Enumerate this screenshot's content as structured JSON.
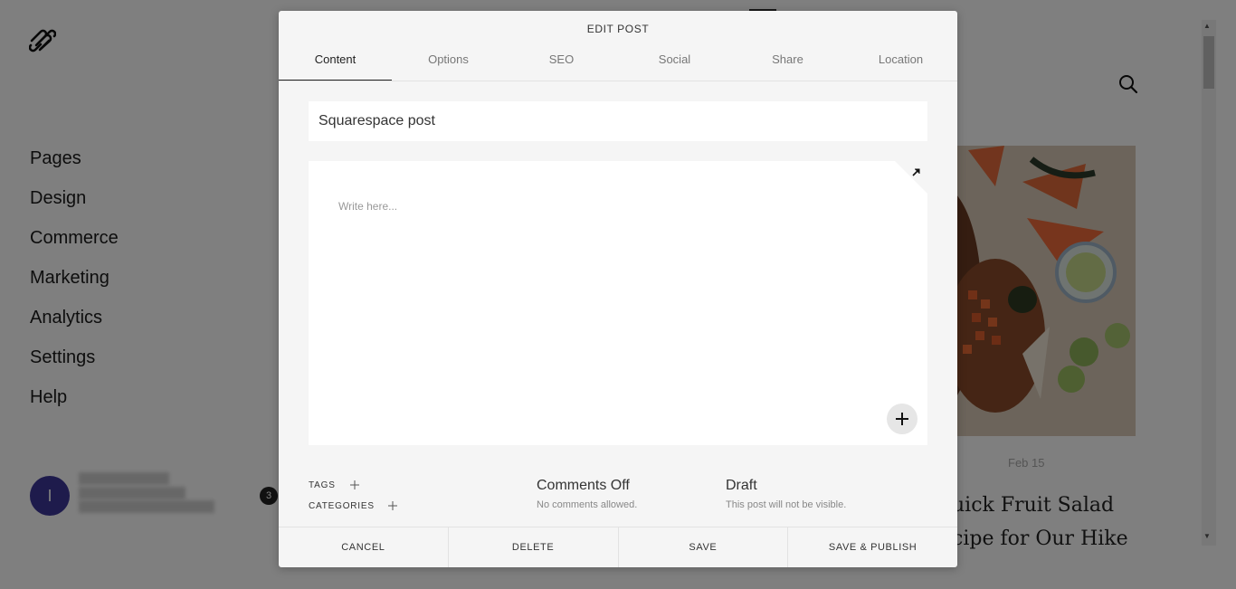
{
  "sidebar": {
    "nav_items": [
      "Pages",
      "Design",
      "Commerce",
      "Marketing",
      "Analytics",
      "Settings",
      "Help"
    ],
    "avatar_initial": "I",
    "notification_count": "3"
  },
  "preview": {
    "post_date": "Feb 15",
    "post_title_line1": "uick Fruit Salad",
    "post_title_line2": "cipe for Our Hike"
  },
  "modal": {
    "title": "EDIT POST",
    "tabs": [
      "Content",
      "Options",
      "SEO",
      "Social",
      "Share",
      "Location"
    ],
    "active_tab": "Content",
    "post_title_value": "Squarespace post",
    "editor_placeholder": "Write here...",
    "tags_label": "TAGS",
    "categories_label": "CATEGORIES",
    "comments": {
      "heading": "Comments Off",
      "sub": "No comments allowed."
    },
    "status": {
      "heading": "Draft",
      "sub": "This post will not be visible."
    },
    "footer": {
      "cancel": "CANCEL",
      "delete": "DELETE",
      "save": "SAVE",
      "save_publish": "SAVE & PUBLISH"
    }
  },
  "colors": {
    "avatar": "#3c3699",
    "overlay": "rgba(0,0,0,0.5)"
  }
}
